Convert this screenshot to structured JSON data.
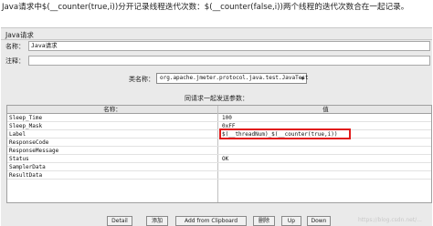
{
  "caption": "Java请求中$(__counter(true,i))分开记录线程迭代次数：$(__counter(false,i))两个线程的迭代次数合在一起记录。",
  "panel": {
    "title": "Java请求",
    "name_label": "名称：",
    "name_value": "Java请求",
    "comment_label": "注释："
  },
  "classname": {
    "label": "类名称：",
    "value": "org.apache.jmeter.protocol.java.test.JavaTest"
  },
  "params": {
    "title": "同请求一起发送参数：",
    "columns": [
      "名称：",
      "值"
    ],
    "rows": [
      {
        "name": "Sleep_Time",
        "value": "100"
      },
      {
        "name": "Sleep_Mask",
        "value": "0xFF"
      },
      {
        "name": "Label",
        "value": "$(__threadNum)_$(__counter(true,i))"
      },
      {
        "name": "ResponseCode",
        "value": ""
      },
      {
        "name": "ResponseMessage",
        "value": ""
      },
      {
        "name": "Status",
        "value": "OK"
      },
      {
        "name": "SamplerData",
        "value": ""
      },
      {
        "name": "ResultData",
        "value": ""
      }
    ]
  },
  "buttons": {
    "detail": "Detail",
    "add": "添加",
    "add_clipboard": "Add from Clipboard",
    "delete": "删除",
    "up": "Up",
    "down": "Down"
  },
  "watermark": "https://blog.csdn.net/..."
}
